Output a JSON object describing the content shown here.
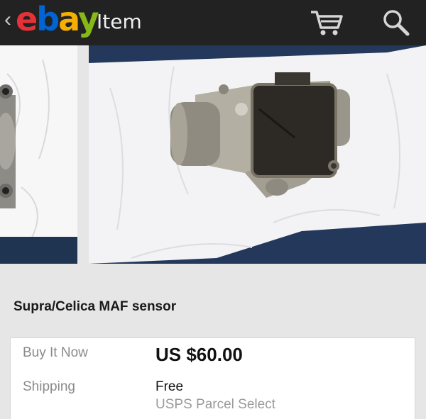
{
  "appbar": {
    "back_glyph": "‹",
    "logo": {
      "e": "e",
      "b": "b",
      "a": "a",
      "y": "y"
    },
    "title": "Item",
    "icons": {
      "back": "chevron-left-icon",
      "cart": "cart-icon",
      "search": "search-icon"
    }
  },
  "gallery": {
    "photos": [
      "previous-photo",
      "main-photo"
    ]
  },
  "item": {
    "title": "Supra/Celica MAF sensor"
  },
  "pricing": {
    "buy_label": "Buy It Now",
    "price": "US $60.00",
    "shipping_label": "Shipping",
    "shipping_value": "Free",
    "shipping_service": "USPS Parcel Select"
  },
  "colors": {
    "appbar_bg": "#222222",
    "logo_red": "#e53238",
    "logo_blue": "#0064d2",
    "logo_yellow": "#f5af02",
    "logo_green": "#86b817"
  }
}
